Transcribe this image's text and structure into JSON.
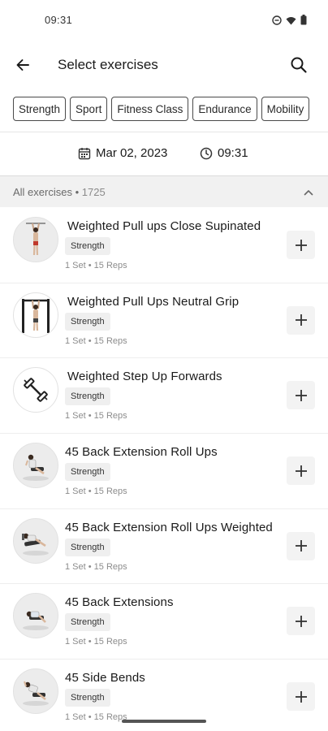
{
  "status": {
    "time": "09:31",
    "icons": [
      "dnd-icon",
      "wifi-icon",
      "battery-icon"
    ]
  },
  "header": {
    "title": "Select exercises",
    "back_icon": "arrow-left-icon",
    "search_icon": "search-icon"
  },
  "filters": [
    "Strength",
    "Sport",
    "Fitness Class",
    "Endurance",
    "Mobility"
  ],
  "session": {
    "date": "Mar 02, 2023",
    "time": "09:31"
  },
  "section": {
    "label": "All exercises",
    "separator": " • ",
    "count": "1725"
  },
  "exercises": [
    {
      "name": "Weighted Pull ups Close Supinated",
      "category": "Strength",
      "meta": "1 Set • 15 Reps",
      "thumb": "pullup-figure",
      "thumb_bg": "grey"
    },
    {
      "name": "Weighted Pull Ups Neutral Grip",
      "category": "Strength",
      "meta": "1 Set • 15 Reps",
      "thumb": "pullup-bar-figure",
      "thumb_bg": "white"
    },
    {
      "name": "Weighted Step Up Forwards",
      "category": "Strength",
      "meta": "1 Set • 15 Reps",
      "thumb": "dumbbell-icon",
      "thumb_bg": "white"
    },
    {
      "name": "45 Back Extension Roll Ups",
      "category": "Strength",
      "meta": "1 Set • 15 Reps",
      "thumb": "back-extension-figure",
      "thumb_bg": "grey"
    },
    {
      "name": "45 Back Extension Roll Ups Weighted",
      "category": "Strength",
      "meta": "1 Set • 15 Reps",
      "thumb": "back-extension-weighted-figure",
      "thumb_bg": "grey"
    },
    {
      "name": "45 Back Extensions",
      "category": "Strength",
      "meta": "1 Set • 15 Reps",
      "thumb": "back-extension-figure",
      "thumb_bg": "grey"
    },
    {
      "name": "45 Side Bends",
      "category": "Strength",
      "meta": "1 Set • 15 Reps",
      "thumb": "side-bend-figure",
      "thumb_bg": "grey"
    }
  ]
}
